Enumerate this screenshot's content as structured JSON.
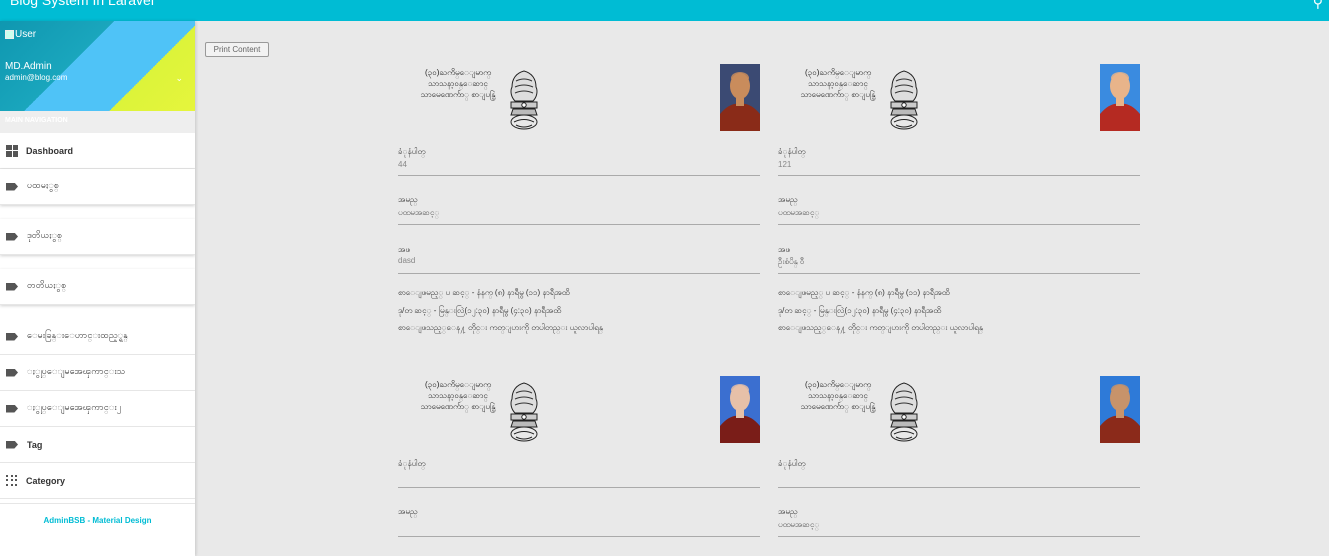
{
  "topbar": {
    "title": "Blog System In Laravel",
    "search_icon": "search-icon"
  },
  "sidebar": {
    "user": {
      "avatar_alt": "User",
      "name": "MD.Admin",
      "email": "admin@blog.com"
    },
    "nav_header": "MAIN NAVIGATION",
    "items": [
      {
        "label": "Dashboard",
        "icon": "dashboard-icon"
      },
      {
        "label": "ပထမႏွစ္",
        "icon": "label-icon"
      },
      {
        "label": "ဒုတိယႏွစ္",
        "icon": "label-icon"
      },
      {
        "label": "တတိယႏွစ္",
        "icon": "label-icon"
      },
      {
        "label": "ေမးခြန္းေဟာင္းထည့္ရန္",
        "icon": "label-icon"
      },
      {
        "label": "ႏွုပ္ေျမအေၾကာင္းသ",
        "icon": "label-icon"
      },
      {
        "label": "ႏွုပ္ေျမအေၾကာင္း၂",
        "icon": "label-icon"
      },
      {
        "label": "Tag",
        "icon": "label-icon"
      },
      {
        "label": "Category",
        "icon": "apps-icon"
      }
    ],
    "footer": "AdminBSB - Material Design"
  },
  "print_button": "Print Content",
  "card_common": {
    "org_line1": "(၃၀)ႀကိမ္ေျမာက္",
    "org_line2": "သာသနာ့ဝန္ေဆာင္",
    "org_line3": "သာမေဏေက်ာ္ စာျပန္ပြဲ",
    "label_number": "ခံုနံပါတ္",
    "label_name": "အမည္",
    "label_father": "အဖ",
    "note1": "စာေျဖမည့္ ပ ဆင့္ - နံနက္ (၈) နာရီမွ (၁၁) နာရီအထိ",
    "note2": "ဒု/တ ဆင့္ - မြန္းလြဲ(၁၂:၃၀) နာရီမွ (၄:၃၀) နာရီအထိ",
    "note3": "စာေျဖသည့္ေန႔ တိုင္း ကတ္ျပားကို တပါတည္း ယူလာပါရန္"
  },
  "cards": [
    {
      "number": "44",
      "name": "ပထမအဆင့္",
      "father": "dasd",
      "robe": "#8a2b18",
      "skin": "#c98c5c",
      "bg": "#3b4a73"
    },
    {
      "number": "121",
      "name": "ပထမအဆင့္",
      "father": "ဦးစံပိန္ ၀ီ",
      "robe": "#b52a22",
      "skin": "#e8b48a",
      "bg": "#3a8be0"
    },
    {
      "number": "",
      "name": "",
      "father": "",
      "robe": "#7a1d18",
      "skin": "#e6c0a8",
      "bg": "#3b6fd0"
    },
    {
      "number": "",
      "name": "ပထမအဆင့္",
      "father": "",
      "robe": "#8b2a1a",
      "skin": "#c7936a",
      "bg": "#2e7ad8"
    }
  ]
}
